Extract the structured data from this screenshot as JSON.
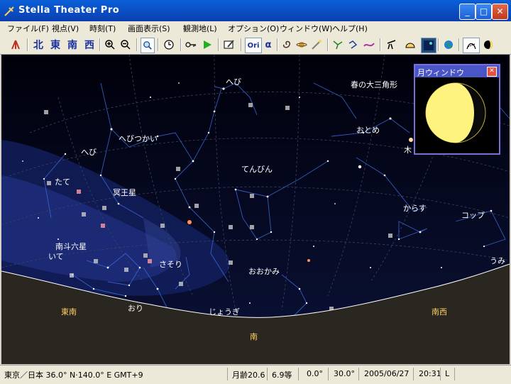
{
  "window": {
    "title": "Stella Theater Pro",
    "min": "_",
    "max": "□",
    "close": "✕"
  },
  "menu": [
    "ファイル(F)",
    "視点(V)",
    "時刻(T)",
    "画面表示(S)",
    "観測地(L)",
    "オプション(O)",
    "ウィンドウ(W)",
    "ヘルプ(H)"
  ],
  "toolbar": {
    "directions": [
      "北",
      "東",
      "南",
      "西"
    ],
    "ori_label": "Ori",
    "alpha_label": "α"
  },
  "sky": {
    "constellations": [
      "へび",
      "春の大三角形",
      "おとめ",
      "へびつかい",
      "へび",
      "てんびん",
      "たて",
      "冥王星",
      "からす",
      "コップ",
      "南斗六星",
      "いて",
      "さそり",
      "おおかみ",
      "うみ",
      "じょうぎ",
      "おり",
      "木"
    ],
    "horizon_directions": [
      "東南",
      "南西",
      "南"
    ]
  },
  "moon_window": {
    "title": "月ウィンドウ",
    "close": "✕"
  },
  "status": {
    "location": "東京／日本  36.0° N·140.0° E  GMT+9",
    "moon_age": "月齢20.6",
    "magnitude": "6.9等",
    "alt": "0.0°",
    "az": "30.0°",
    "date": "2005/06/27",
    "time": "20:31",
    "mode": "L"
  },
  "colors": {
    "sky_top": "#000008",
    "milky_way": "#1a2a6a",
    "horizon": "#2a2620",
    "constellation_line": "#3a6ad8",
    "label_dir": "#ffd060"
  }
}
